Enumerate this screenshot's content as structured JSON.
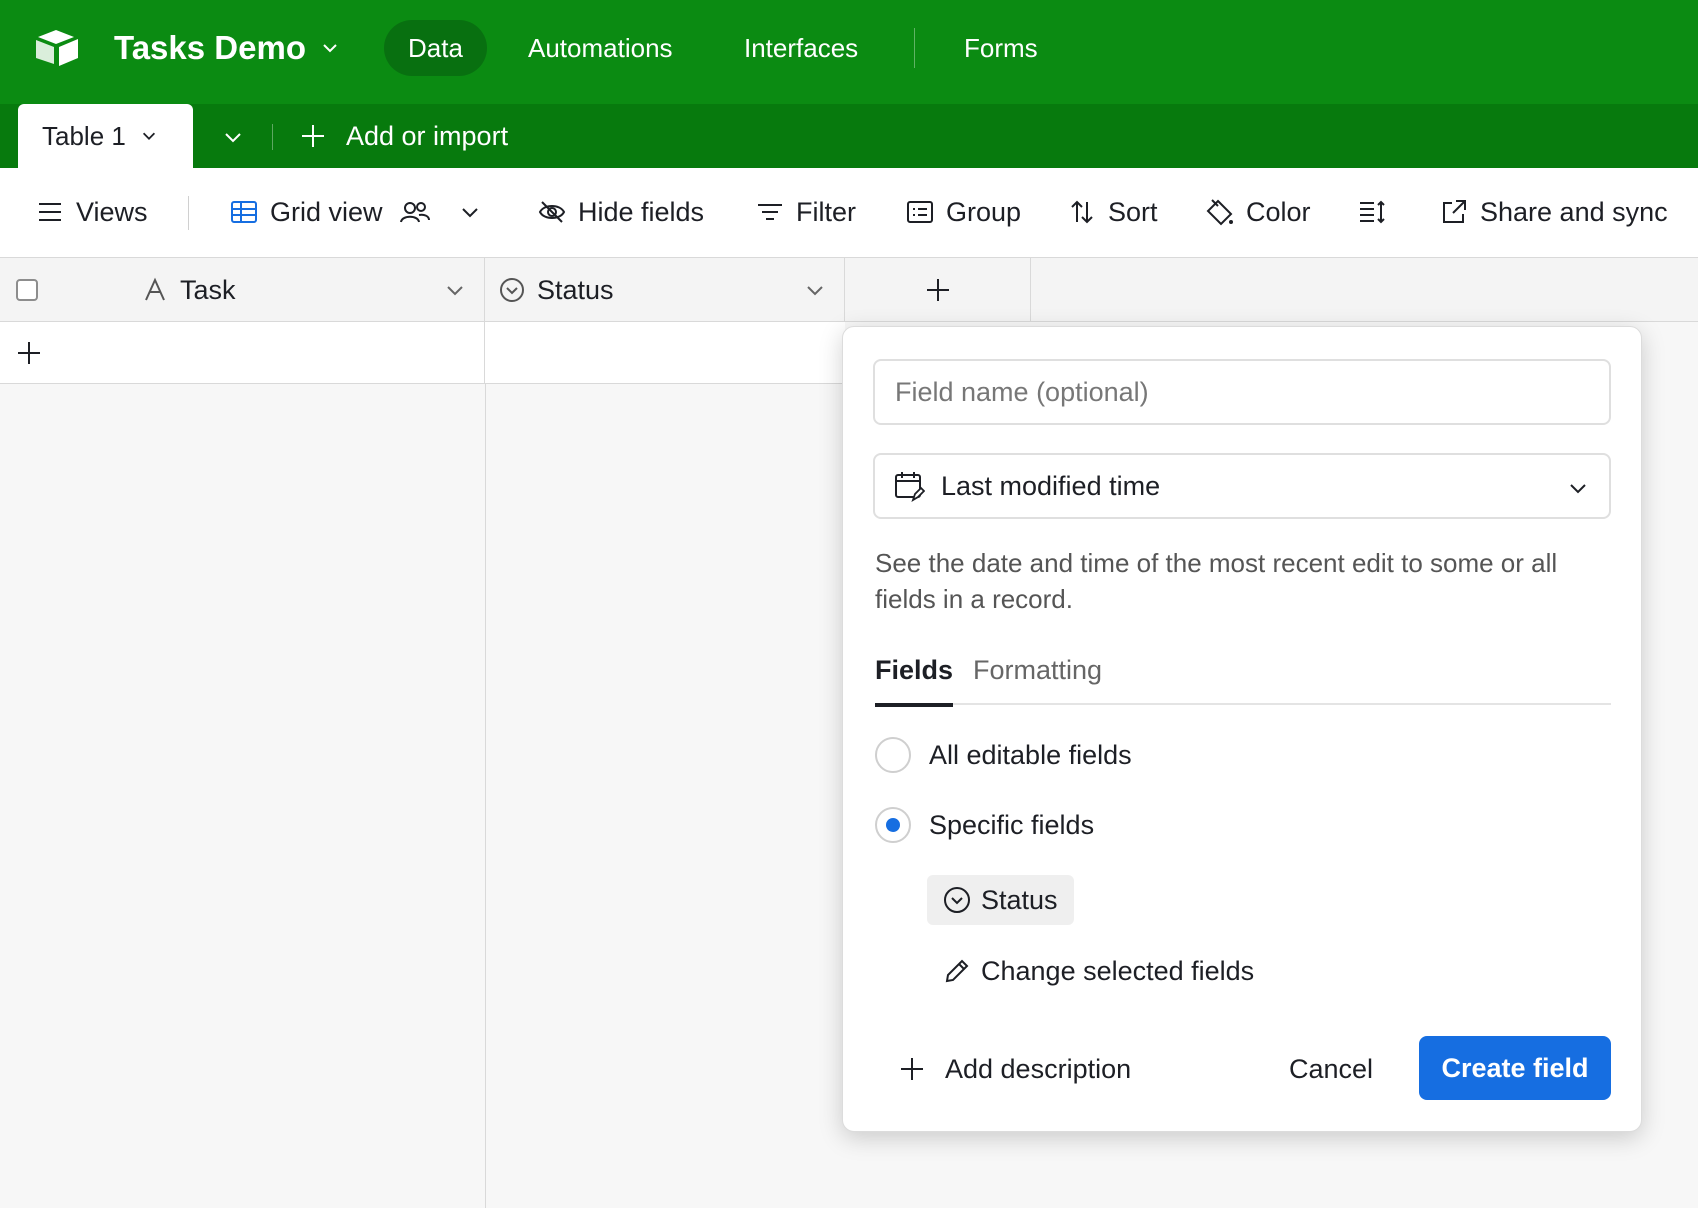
{
  "app": {
    "base_name": "Tasks Demo",
    "nav": [
      "Data",
      "Automations",
      "Interfaces",
      "Forms"
    ],
    "active_nav": "Data",
    "brand_color": "#0b8b12"
  },
  "tablebar": {
    "table_name": "Table 1",
    "add_import_label": "Add or import"
  },
  "viewbar": {
    "views_label": "Views",
    "view_name": "Grid view",
    "hide_fields": "Hide fields",
    "filter": "Filter",
    "group": "Group",
    "sort": "Sort",
    "color": "Color",
    "share": "Share and sync"
  },
  "grid": {
    "columns": [
      {
        "name": "Task",
        "icon": "text-a-icon"
      },
      {
        "name": "Status",
        "icon": "chevron-circle-icon"
      }
    ]
  },
  "popup": {
    "name_placeholder": "Field name (optional)",
    "name_value": "",
    "field_type": "Last modified time",
    "description": "See the date and time of the most recent edit to some or all fields in a record.",
    "tabs": [
      "Fields",
      "Formatting"
    ],
    "active_tab": "Fields",
    "options": [
      "All editable fields",
      "Specific fields"
    ],
    "selected_option": "Specific fields",
    "selected_field": "Status",
    "change_fields_label": "Change selected fields",
    "add_description_label": "Add description",
    "cancel_label": "Cancel",
    "create_label": "Create field",
    "accent_color": "#166ee1"
  }
}
